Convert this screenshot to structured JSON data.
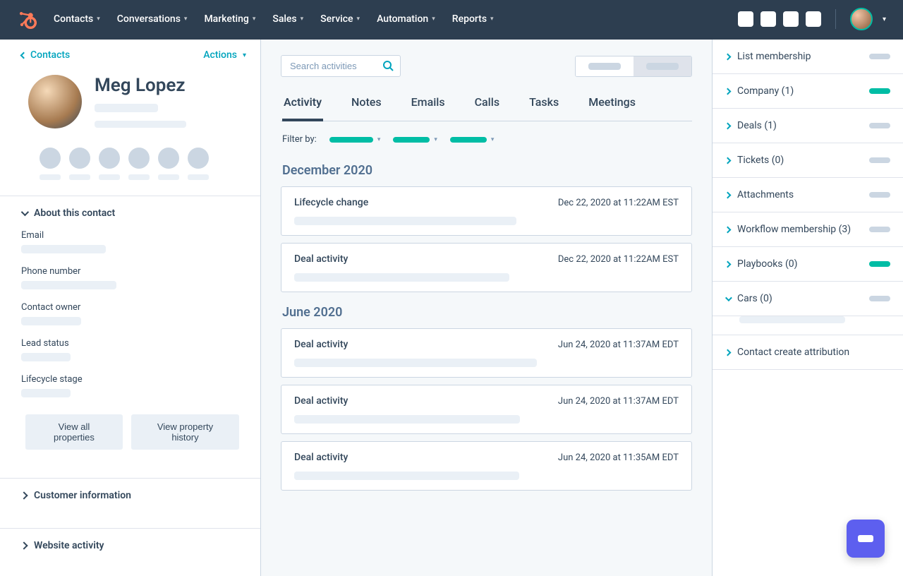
{
  "topnav": {
    "items": [
      "Contacts",
      "Conversations",
      "Marketing",
      "Sales",
      "Service",
      "Automation",
      "Reports"
    ]
  },
  "left": {
    "back_label": "Contacts",
    "actions_label": "Actions",
    "contact_name": "Meg Lopez",
    "about_label": "About this contact",
    "fields": [
      "Email",
      "Phone number",
      "Contact owner",
      "Lead status",
      "Lifecycle stage"
    ],
    "btn_all_properties": "View all properties",
    "btn_history": "View property history",
    "accordion_customer_info": "Customer information",
    "accordion_website": "Website activity"
  },
  "center": {
    "search_placeholder": "Search activities",
    "tabs": [
      "Activity",
      "Notes",
      "Emails",
      "Calls",
      "Tasks",
      "Meetings"
    ],
    "active_tab": 0,
    "filter_label": "Filter by:",
    "groups": [
      {
        "heading": "December 2020",
        "items": [
          {
            "title": "Lifecycle change",
            "date": "Dec 22, 2020 at 11:22AM EST"
          },
          {
            "title": "Deal activity",
            "date": "Dec 22, 2020 at 11:22AM EST"
          }
        ]
      },
      {
        "heading": "June 2020",
        "items": [
          {
            "title": "Deal activity",
            "date": "Jun 24, 2020 at 11:37AM EDT"
          },
          {
            "title": "Deal activity",
            "date": "Jun 24, 2020 at 11:37AM EDT"
          },
          {
            "title": "Deal activity",
            "date": "Jun 24, 2020 at 11:35AM EDT"
          }
        ]
      }
    ]
  },
  "right": {
    "items": [
      {
        "label": "List membership",
        "pill": "grey",
        "chev": "right"
      },
      {
        "label": "Company (1)",
        "pill": "teal",
        "chev": "right"
      },
      {
        "label": "Deals (1)",
        "pill": "grey",
        "chev": "right"
      },
      {
        "label": "Tickets (0)",
        "pill": "grey",
        "chev": "right"
      },
      {
        "label": "Attachments",
        "pill": "grey",
        "chev": "right"
      },
      {
        "label": "Workflow membership (3)",
        "pill": "grey",
        "chev": "right"
      },
      {
        "label": "Playbooks (0)",
        "pill": "teal",
        "chev": "right"
      },
      {
        "label": "Cars (0)",
        "pill": "grey",
        "chev": "down",
        "expanded": true
      },
      {
        "label": "Contact create attribution",
        "pill": "",
        "chev": "right"
      }
    ]
  }
}
